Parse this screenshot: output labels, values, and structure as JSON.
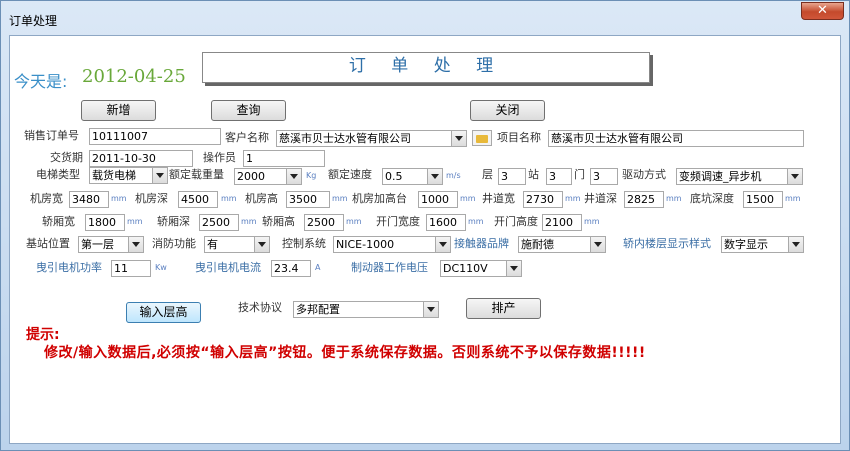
{
  "window": {
    "title": "订单处理",
    "close_label": "✕"
  },
  "header": {
    "title": "订 单 处 理"
  },
  "today": {
    "label": "今天是:",
    "date": "2012-04-25"
  },
  "toolbar": {
    "add": "新增",
    "query": "查询",
    "close": "关闭"
  },
  "order": {
    "order_no_label": "销售订单号",
    "order_no": "10111007",
    "customer_label": "客户名称",
    "customer": "慈溪市贝士达水管有限公司",
    "project_label": "项目名称",
    "project": "慈溪市贝士达水管有限公司",
    "delivery_label": "交货期",
    "delivery": "2011-10-30",
    "operator_label": "操作员",
    "operator": "1"
  },
  "elevator": {
    "type_label": "电梯类型",
    "type": "载货电梯",
    "load_label": "额定载重量",
    "load": "2000",
    "load_unit": "Kg",
    "speed_label": "额定速度",
    "speed": "0.5",
    "speed_unit": "m/s",
    "floors_label": "层",
    "floors": "3",
    "stations_label": "站",
    "stations": "3",
    "doors_label": "门",
    "doors": "3",
    "drive_label": "驱动方式",
    "drive": "变频调速_异步机"
  },
  "room": {
    "width_label": "机房宽",
    "width": "3480",
    "depth_label": "机房深",
    "depth": "4500",
    "height_label": "机房高",
    "height": "3500",
    "platform_label": "机房加高台",
    "platform": "1000",
    "shaft_w_label": "井道宽",
    "shaft_w": "2730",
    "shaft_d_label": "井道深",
    "shaft_d": "2825",
    "pit_label": "底坑深度",
    "pit": "1500",
    "unit": "mm"
  },
  "car": {
    "width_label": "轿厢宽",
    "width": "1800",
    "depth_label": "轿厢深",
    "depth": "2500",
    "height_label": "轿厢高",
    "height": "2500",
    "door_w_label": "开门宽度",
    "door_w": "1600",
    "door_h_label": "开门高度",
    "door_h": "2100",
    "unit": "mm"
  },
  "misc": {
    "base_label": "基站位置",
    "base": "第一层",
    "fire_label": "消防功能",
    "fire": "有",
    "control_label": "控制系统",
    "control": "NICE-1000",
    "contactor_label": "接触器品牌",
    "contactor": "施耐德",
    "display_label": "轿内楼层显示样式",
    "display": "数字显示",
    "motor_power_label": "曳引电机功率",
    "motor_power": "11",
    "motor_power_unit": "Kw",
    "motor_current_label": "曳引电机电流",
    "motor_current": "23.4",
    "motor_current_unit": "A",
    "brake_label": "制动器工作电压",
    "brake": "DC110V"
  },
  "actions": {
    "input_height": "输入层高",
    "protocol_label": "技术协议",
    "protocol": "多邦配置",
    "schedule": "排产"
  },
  "tip": {
    "title": "提示:",
    "body": "修改/输入数据后,必须按“输入层高”按钮。便于系统保存数据。否则系统不予以保存数据!!!!!"
  }
}
